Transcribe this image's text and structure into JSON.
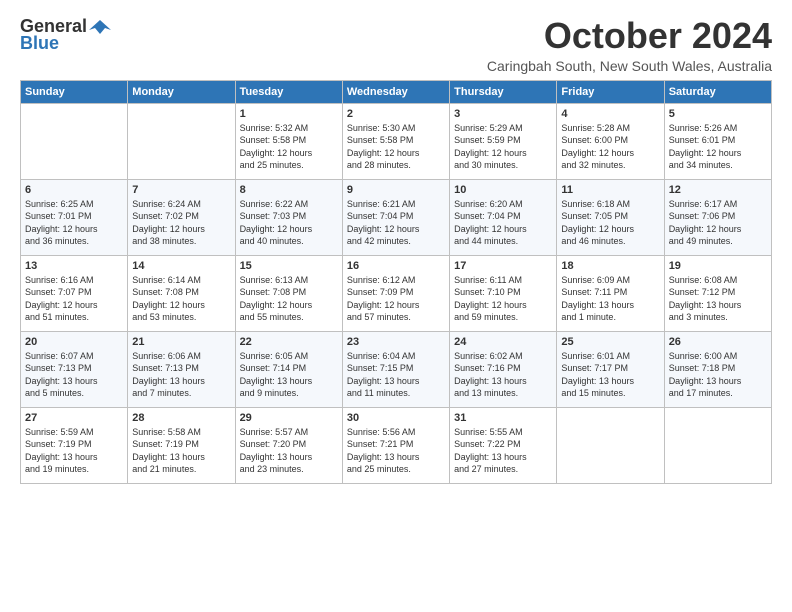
{
  "logo": {
    "general": "General",
    "blue": "Blue"
  },
  "header": {
    "month": "October 2024",
    "location": "Caringbah South, New South Wales, Australia"
  },
  "days_of_week": [
    "Sunday",
    "Monday",
    "Tuesday",
    "Wednesday",
    "Thursday",
    "Friday",
    "Saturday"
  ],
  "weeks": [
    [
      {
        "day": "",
        "info": ""
      },
      {
        "day": "",
        "info": ""
      },
      {
        "day": "1",
        "info": "Sunrise: 5:32 AM\nSunset: 5:58 PM\nDaylight: 12 hours\nand 25 minutes."
      },
      {
        "day": "2",
        "info": "Sunrise: 5:30 AM\nSunset: 5:58 PM\nDaylight: 12 hours\nand 28 minutes."
      },
      {
        "day": "3",
        "info": "Sunrise: 5:29 AM\nSunset: 5:59 PM\nDaylight: 12 hours\nand 30 minutes."
      },
      {
        "day": "4",
        "info": "Sunrise: 5:28 AM\nSunset: 6:00 PM\nDaylight: 12 hours\nand 32 minutes."
      },
      {
        "day": "5",
        "info": "Sunrise: 5:26 AM\nSunset: 6:01 PM\nDaylight: 12 hours\nand 34 minutes."
      }
    ],
    [
      {
        "day": "6",
        "info": "Sunrise: 6:25 AM\nSunset: 7:01 PM\nDaylight: 12 hours\nand 36 minutes."
      },
      {
        "day": "7",
        "info": "Sunrise: 6:24 AM\nSunset: 7:02 PM\nDaylight: 12 hours\nand 38 minutes."
      },
      {
        "day": "8",
        "info": "Sunrise: 6:22 AM\nSunset: 7:03 PM\nDaylight: 12 hours\nand 40 minutes."
      },
      {
        "day": "9",
        "info": "Sunrise: 6:21 AM\nSunset: 7:04 PM\nDaylight: 12 hours\nand 42 minutes."
      },
      {
        "day": "10",
        "info": "Sunrise: 6:20 AM\nSunset: 7:04 PM\nDaylight: 12 hours\nand 44 minutes."
      },
      {
        "day": "11",
        "info": "Sunrise: 6:18 AM\nSunset: 7:05 PM\nDaylight: 12 hours\nand 46 minutes."
      },
      {
        "day": "12",
        "info": "Sunrise: 6:17 AM\nSunset: 7:06 PM\nDaylight: 12 hours\nand 49 minutes."
      }
    ],
    [
      {
        "day": "13",
        "info": "Sunrise: 6:16 AM\nSunset: 7:07 PM\nDaylight: 12 hours\nand 51 minutes."
      },
      {
        "day": "14",
        "info": "Sunrise: 6:14 AM\nSunset: 7:08 PM\nDaylight: 12 hours\nand 53 minutes."
      },
      {
        "day": "15",
        "info": "Sunrise: 6:13 AM\nSunset: 7:08 PM\nDaylight: 12 hours\nand 55 minutes."
      },
      {
        "day": "16",
        "info": "Sunrise: 6:12 AM\nSunset: 7:09 PM\nDaylight: 12 hours\nand 57 minutes."
      },
      {
        "day": "17",
        "info": "Sunrise: 6:11 AM\nSunset: 7:10 PM\nDaylight: 12 hours\nand 59 minutes."
      },
      {
        "day": "18",
        "info": "Sunrise: 6:09 AM\nSunset: 7:11 PM\nDaylight: 13 hours\nand 1 minute."
      },
      {
        "day": "19",
        "info": "Sunrise: 6:08 AM\nSunset: 7:12 PM\nDaylight: 13 hours\nand 3 minutes."
      }
    ],
    [
      {
        "day": "20",
        "info": "Sunrise: 6:07 AM\nSunset: 7:13 PM\nDaylight: 13 hours\nand 5 minutes."
      },
      {
        "day": "21",
        "info": "Sunrise: 6:06 AM\nSunset: 7:13 PM\nDaylight: 13 hours\nand 7 minutes."
      },
      {
        "day": "22",
        "info": "Sunrise: 6:05 AM\nSunset: 7:14 PM\nDaylight: 13 hours\nand 9 minutes."
      },
      {
        "day": "23",
        "info": "Sunrise: 6:04 AM\nSunset: 7:15 PM\nDaylight: 13 hours\nand 11 minutes."
      },
      {
        "day": "24",
        "info": "Sunrise: 6:02 AM\nSunset: 7:16 PM\nDaylight: 13 hours\nand 13 minutes."
      },
      {
        "day": "25",
        "info": "Sunrise: 6:01 AM\nSunset: 7:17 PM\nDaylight: 13 hours\nand 15 minutes."
      },
      {
        "day": "26",
        "info": "Sunrise: 6:00 AM\nSunset: 7:18 PM\nDaylight: 13 hours\nand 17 minutes."
      }
    ],
    [
      {
        "day": "27",
        "info": "Sunrise: 5:59 AM\nSunset: 7:19 PM\nDaylight: 13 hours\nand 19 minutes."
      },
      {
        "day": "28",
        "info": "Sunrise: 5:58 AM\nSunset: 7:19 PM\nDaylight: 13 hours\nand 21 minutes."
      },
      {
        "day": "29",
        "info": "Sunrise: 5:57 AM\nSunset: 7:20 PM\nDaylight: 13 hours\nand 23 minutes."
      },
      {
        "day": "30",
        "info": "Sunrise: 5:56 AM\nSunset: 7:21 PM\nDaylight: 13 hours\nand 25 minutes."
      },
      {
        "day": "31",
        "info": "Sunrise: 5:55 AM\nSunset: 7:22 PM\nDaylight: 13 hours\nand 27 minutes."
      },
      {
        "day": "",
        "info": ""
      },
      {
        "day": "",
        "info": ""
      }
    ]
  ]
}
